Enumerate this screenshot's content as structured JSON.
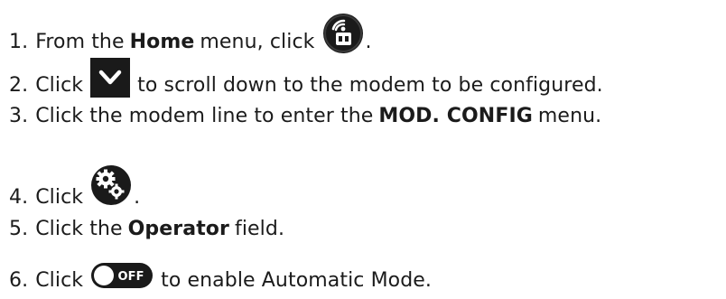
{
  "steps": [
    {
      "number": "1.",
      "before": "From the",
      "bold": "Home",
      "after": "menu, click",
      "icon": "antenna-signal-icon",
      "end": "."
    },
    {
      "number": "2.",
      "before": "Click",
      "icon": "chevron-down-icon",
      "after": "to scroll down to the modem to be configured."
    },
    {
      "number": "3.",
      "before": "Click the modem line to enter the",
      "bold": "MOD. CONFIG",
      "after": "menu."
    },
    {
      "number": "4.",
      "before": "Click",
      "icon": "gears-icon",
      "end": "."
    },
    {
      "number": "5.",
      "before": "Click the",
      "bold": "Operator",
      "after": "field."
    },
    {
      "number": "6.",
      "before": "Click",
      "icon": "toggle-off-icon",
      "icon_text": "OFF",
      "after": "to enable Automatic Mode."
    }
  ],
  "colors": {
    "text": "#1b1b1b",
    "icon_dark": "#1a1a1a",
    "icon_light": "#ffffff"
  }
}
